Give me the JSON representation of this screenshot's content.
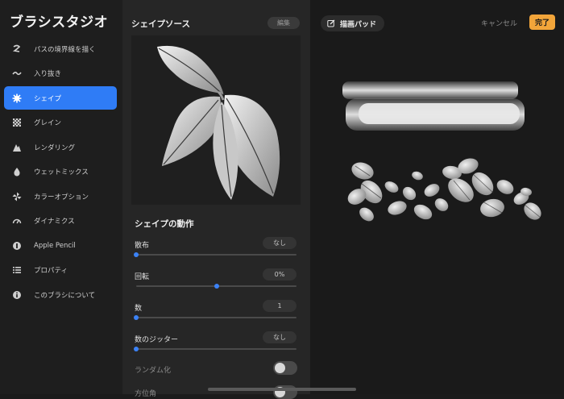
{
  "sidebar": {
    "title": "ブラシスタジオ",
    "items": [
      {
        "label": "パスの境界線を描く",
        "icon": "stroke-path-icon"
      },
      {
        "label": "入り抜き",
        "icon": "taper-icon"
      },
      {
        "label": "シェイプ",
        "icon": "shape-gear-icon",
        "active": true
      },
      {
        "label": "グレイン",
        "icon": "grain-icon"
      },
      {
        "label": "レンダリング",
        "icon": "rendering-icon"
      },
      {
        "label": "ウェットミックス",
        "icon": "wet-mix-drop-icon"
      },
      {
        "label": "カラーオプション",
        "icon": "color-pinwheel-icon"
      },
      {
        "label": "ダイナミクス",
        "icon": "dynamics-gauge-icon"
      },
      {
        "label": "Apple Pencil",
        "icon": "apple-pencil-icon"
      },
      {
        "label": "プロパティ",
        "icon": "properties-list-icon"
      },
      {
        "label": "このブラシについて",
        "icon": "info-icon"
      }
    ]
  },
  "shape_source": {
    "title": "シェイプソース",
    "edit_label": "編集"
  },
  "shape_behavior": {
    "title": "シェイプの動作",
    "rows": [
      {
        "label": "散布",
        "value": "なし",
        "level": 0.0
      },
      {
        "label": "回転",
        "value": "0%",
        "level": 0.5
      },
      {
        "label": "数",
        "value": "1",
        "level": 0.0
      },
      {
        "label": "数のジッター",
        "value": "なし",
        "level": 0.0
      }
    ],
    "randomize_label": "ランダム化",
    "randomize_on": false,
    "azimuth_label": "方位角",
    "azimuth_on": false
  },
  "drawing_pad": {
    "label": "描画パッド",
    "cancel_label": "キャンセル",
    "done_label": "完了"
  },
  "colors": {
    "accent": "#2f7cf6",
    "done": "#f2a53a"
  }
}
